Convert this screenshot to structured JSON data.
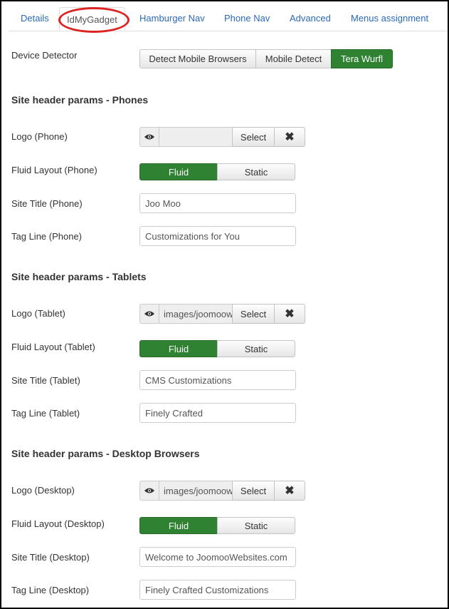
{
  "tabs": [
    "Details",
    "IdMyGadget",
    "Hamburger Nav",
    "Phone Nav",
    "Advanced",
    "Menus assignment"
  ],
  "device_detector": {
    "label": "Device Detector",
    "options": [
      "Detect Mobile Browsers",
      "Mobile Detect",
      "Tera Wurfl"
    ],
    "selected": "Tera Wurfl"
  },
  "toggle_labels": {
    "fluid": "Fluid",
    "static": "Static"
  },
  "media": {
    "select_label": "Select",
    "clear_icon": "close-icon",
    "preview_icon": "eye-icon"
  },
  "sections": {
    "phones": {
      "heading": "Site header params - Phones",
      "logo_label": "Logo (Phone)",
      "logo_value": "",
      "fluid_label": "Fluid Layout (Phone)",
      "fluid_selected": "Fluid",
      "title_label": "Site Title (Phone)",
      "title_value": "Joo Moo",
      "tagline_label": "Tag Line (Phone)",
      "tagline_value": "Customizations for You"
    },
    "tablets": {
      "heading": "Site header params - Tablets",
      "logo_label": "Logo (Tablet)",
      "logo_value": "images/joomoow",
      "fluid_label": "Fluid Layout (Tablet)",
      "fluid_selected": "Fluid",
      "title_label": "Site Title (Tablet)",
      "title_value": "CMS Customizations",
      "tagline_label": "Tag Line (Tablet)",
      "tagline_value": "Finely Crafted"
    },
    "desktop": {
      "heading": "Site header params - Desktop Browsers",
      "logo_label": "Logo (Desktop)",
      "logo_value": "images/joomoow",
      "fluid_label": "Fluid Layout (Desktop)",
      "fluid_selected": "Fluid",
      "title_label": "Site Title (Desktop)",
      "title_value": "Welcome to JoomooWebsites.com",
      "tagline_label": "Tag Line (Desktop)",
      "tagline_value": "Finely Crafted Customizations"
    }
  },
  "colors": {
    "link": "#2a69b8",
    "active_green": "#2f8231",
    "highlight_circle": "#dd2222"
  }
}
